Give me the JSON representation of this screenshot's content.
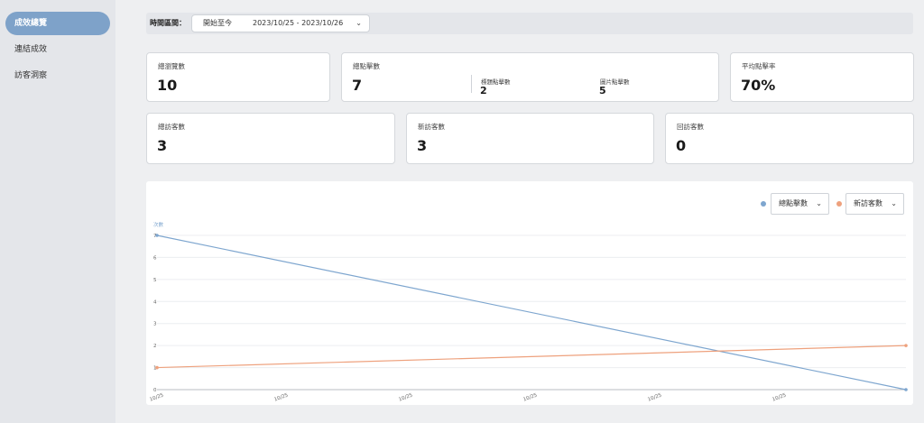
{
  "sidebar": {
    "items": [
      {
        "label": "成效總覽",
        "active": true
      },
      {
        "label": "連結成效",
        "active": false
      },
      {
        "label": "訪客洞察",
        "active": false
      }
    ]
  },
  "filter": {
    "label": "時間區間：",
    "mode": "開始至今",
    "range": "2023/10/25 - 2023/10/26"
  },
  "cards": {
    "total_views": {
      "label": "總瀏覽數",
      "value": "10"
    },
    "total_clicks": {
      "label": "總點擊數",
      "value": "7",
      "sub": [
        {
          "label": "標題點擊數",
          "value": "2"
        },
        {
          "label": "圖片點擊數",
          "value": "5"
        }
      ]
    },
    "avg_ctr": {
      "label": "平均點擊率",
      "value": "70%"
    },
    "total_visitors": {
      "label": "總訪客數",
      "value": "3"
    },
    "new_visitors": {
      "label": "新訪客數",
      "value": "3"
    },
    "returning_visitors": {
      "label": "回訪客數",
      "value": "0"
    }
  },
  "legend": {
    "series1": {
      "label": "總點擊數",
      "color": "#7ea6cf"
    },
    "series2": {
      "label": "新訪客數",
      "color": "#eea17d"
    }
  },
  "chart_data": {
    "type": "line",
    "ylabel": "次數",
    "ylim": [
      0,
      7
    ],
    "yticks": [
      0,
      1,
      2,
      3,
      4,
      5,
      6,
      7
    ],
    "x_tick_labels": [
      "10/25",
      "10/25",
      "10/25",
      "10/25",
      "10/25",
      "10/25"
    ],
    "series": [
      {
        "name": "總點擊數",
        "color": "#7ea6cf",
        "points": [
          [
            0,
            7
          ],
          [
            1,
            0
          ]
        ]
      },
      {
        "name": "新訪客數",
        "color": "#eea17d",
        "points": [
          [
            0,
            1
          ],
          [
            1,
            2
          ]
        ]
      }
    ]
  }
}
